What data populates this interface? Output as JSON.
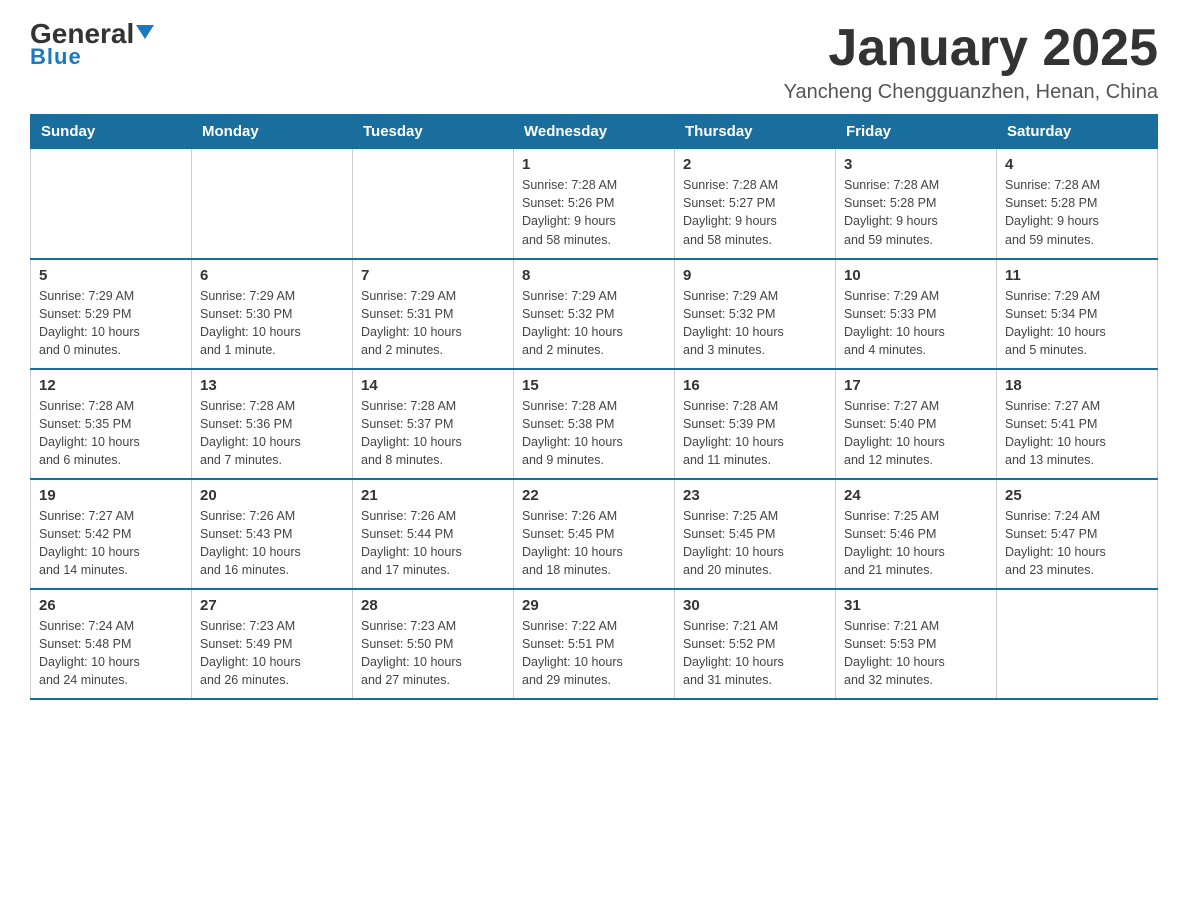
{
  "header": {
    "logo": {
      "general": "General",
      "blue": "Blue"
    },
    "title": "January 2025",
    "location": "Yancheng Chengguanzhen, Henan, China"
  },
  "calendar": {
    "days_of_week": [
      "Sunday",
      "Monday",
      "Tuesday",
      "Wednesday",
      "Thursday",
      "Friday",
      "Saturday"
    ],
    "weeks": [
      [
        {
          "day": "",
          "info": ""
        },
        {
          "day": "",
          "info": ""
        },
        {
          "day": "",
          "info": ""
        },
        {
          "day": "1",
          "info": "Sunrise: 7:28 AM\nSunset: 5:26 PM\nDaylight: 9 hours\nand 58 minutes."
        },
        {
          "day": "2",
          "info": "Sunrise: 7:28 AM\nSunset: 5:27 PM\nDaylight: 9 hours\nand 58 minutes."
        },
        {
          "day": "3",
          "info": "Sunrise: 7:28 AM\nSunset: 5:28 PM\nDaylight: 9 hours\nand 59 minutes."
        },
        {
          "day": "4",
          "info": "Sunrise: 7:28 AM\nSunset: 5:28 PM\nDaylight: 9 hours\nand 59 minutes."
        }
      ],
      [
        {
          "day": "5",
          "info": "Sunrise: 7:29 AM\nSunset: 5:29 PM\nDaylight: 10 hours\nand 0 minutes."
        },
        {
          "day": "6",
          "info": "Sunrise: 7:29 AM\nSunset: 5:30 PM\nDaylight: 10 hours\nand 1 minute."
        },
        {
          "day": "7",
          "info": "Sunrise: 7:29 AM\nSunset: 5:31 PM\nDaylight: 10 hours\nand 2 minutes."
        },
        {
          "day": "8",
          "info": "Sunrise: 7:29 AM\nSunset: 5:32 PM\nDaylight: 10 hours\nand 2 minutes."
        },
        {
          "day": "9",
          "info": "Sunrise: 7:29 AM\nSunset: 5:32 PM\nDaylight: 10 hours\nand 3 minutes."
        },
        {
          "day": "10",
          "info": "Sunrise: 7:29 AM\nSunset: 5:33 PM\nDaylight: 10 hours\nand 4 minutes."
        },
        {
          "day": "11",
          "info": "Sunrise: 7:29 AM\nSunset: 5:34 PM\nDaylight: 10 hours\nand 5 minutes."
        }
      ],
      [
        {
          "day": "12",
          "info": "Sunrise: 7:28 AM\nSunset: 5:35 PM\nDaylight: 10 hours\nand 6 minutes."
        },
        {
          "day": "13",
          "info": "Sunrise: 7:28 AM\nSunset: 5:36 PM\nDaylight: 10 hours\nand 7 minutes."
        },
        {
          "day": "14",
          "info": "Sunrise: 7:28 AM\nSunset: 5:37 PM\nDaylight: 10 hours\nand 8 minutes."
        },
        {
          "day": "15",
          "info": "Sunrise: 7:28 AM\nSunset: 5:38 PM\nDaylight: 10 hours\nand 9 minutes."
        },
        {
          "day": "16",
          "info": "Sunrise: 7:28 AM\nSunset: 5:39 PM\nDaylight: 10 hours\nand 11 minutes."
        },
        {
          "day": "17",
          "info": "Sunrise: 7:27 AM\nSunset: 5:40 PM\nDaylight: 10 hours\nand 12 minutes."
        },
        {
          "day": "18",
          "info": "Sunrise: 7:27 AM\nSunset: 5:41 PM\nDaylight: 10 hours\nand 13 minutes."
        }
      ],
      [
        {
          "day": "19",
          "info": "Sunrise: 7:27 AM\nSunset: 5:42 PM\nDaylight: 10 hours\nand 14 minutes."
        },
        {
          "day": "20",
          "info": "Sunrise: 7:26 AM\nSunset: 5:43 PM\nDaylight: 10 hours\nand 16 minutes."
        },
        {
          "day": "21",
          "info": "Sunrise: 7:26 AM\nSunset: 5:44 PM\nDaylight: 10 hours\nand 17 minutes."
        },
        {
          "day": "22",
          "info": "Sunrise: 7:26 AM\nSunset: 5:45 PM\nDaylight: 10 hours\nand 18 minutes."
        },
        {
          "day": "23",
          "info": "Sunrise: 7:25 AM\nSunset: 5:45 PM\nDaylight: 10 hours\nand 20 minutes."
        },
        {
          "day": "24",
          "info": "Sunrise: 7:25 AM\nSunset: 5:46 PM\nDaylight: 10 hours\nand 21 minutes."
        },
        {
          "day": "25",
          "info": "Sunrise: 7:24 AM\nSunset: 5:47 PM\nDaylight: 10 hours\nand 23 minutes."
        }
      ],
      [
        {
          "day": "26",
          "info": "Sunrise: 7:24 AM\nSunset: 5:48 PM\nDaylight: 10 hours\nand 24 minutes."
        },
        {
          "day": "27",
          "info": "Sunrise: 7:23 AM\nSunset: 5:49 PM\nDaylight: 10 hours\nand 26 minutes."
        },
        {
          "day": "28",
          "info": "Sunrise: 7:23 AM\nSunset: 5:50 PM\nDaylight: 10 hours\nand 27 minutes."
        },
        {
          "day": "29",
          "info": "Sunrise: 7:22 AM\nSunset: 5:51 PM\nDaylight: 10 hours\nand 29 minutes."
        },
        {
          "day": "30",
          "info": "Sunrise: 7:21 AM\nSunset: 5:52 PM\nDaylight: 10 hours\nand 31 minutes."
        },
        {
          "day": "31",
          "info": "Sunrise: 7:21 AM\nSunset: 5:53 PM\nDaylight: 10 hours\nand 32 minutes."
        },
        {
          "day": "",
          "info": ""
        }
      ]
    ]
  }
}
